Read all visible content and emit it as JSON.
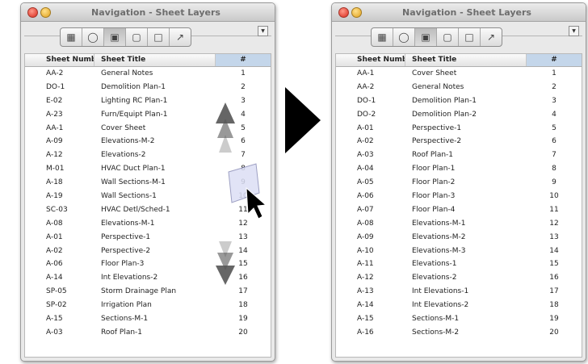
{
  "window_title": "Navigation - Sheet Layers",
  "toolbar_icons": [
    "layers-icon",
    "database-icon",
    "sheet-layers-icon",
    "viewports-icon",
    "document-icon",
    "magic-wand-icon"
  ],
  "columns": {
    "number": "Sheet Number",
    "title": "Sheet Title",
    "order": "#"
  },
  "left_rows": [
    {
      "num": "AA-2",
      "title": "General Notes",
      "idx": "1"
    },
    {
      "num": "DO-1",
      "title": "Demolition Plan-1",
      "idx": "2"
    },
    {
      "num": "E-02",
      "title": "Lighting RC Plan-1",
      "idx": "3"
    },
    {
      "num": "A-23",
      "title": "Furn/Equipt Plan-1",
      "idx": "4"
    },
    {
      "num": "AA-1",
      "title": "Cover Sheet",
      "idx": "5"
    },
    {
      "num": "A-09",
      "title": "Elevations-M-2",
      "idx": "6"
    },
    {
      "num": "A-12",
      "title": "Elevations-2",
      "idx": "7"
    },
    {
      "num": "M-01",
      "title": "HVAC Duct Plan-1",
      "idx": "8"
    },
    {
      "num": "A-18",
      "title": "Wall Sections-M-1",
      "idx": "9"
    },
    {
      "num": "A-19",
      "title": "Wall Sections-1",
      "idx": "10"
    },
    {
      "num": "SC-03",
      "title": "HVAC Detl/Sched-1",
      "idx": "11"
    },
    {
      "num": "A-08",
      "title": "Elevations-M-1",
      "idx": "12"
    },
    {
      "num": "A-01",
      "title": "Perspective-1",
      "idx": "13"
    },
    {
      "num": "A-02",
      "title": "Perspective-2",
      "idx": "14"
    },
    {
      "num": "A-06",
      "title": "Floor Plan-3",
      "idx": "15"
    },
    {
      "num": "A-14",
      "title": "Int Elevations-2",
      "idx": "16"
    },
    {
      "num": "SP-05",
      "title": "Storm Drainage Plan",
      "idx": "17"
    },
    {
      "num": "SP-02",
      "title": "Irrigation Plan",
      "idx": "18"
    },
    {
      "num": "A-15",
      "title": "Sections-M-1",
      "idx": "19"
    },
    {
      "num": "A-03",
      "title": "Roof Plan-1",
      "idx": "20"
    }
  ],
  "right_rows": [
    {
      "num": "AA-1",
      "title": "Cover Sheet",
      "idx": "1"
    },
    {
      "num": "AA-2",
      "title": "General Notes",
      "idx": "2"
    },
    {
      "num": "DO-1",
      "title": "Demolition Plan-1",
      "idx": "3"
    },
    {
      "num": "DO-2",
      "title": "Demolition Plan-2",
      "idx": "4"
    },
    {
      "num": "A-01",
      "title": "Perspective-1",
      "idx": "5"
    },
    {
      "num": "A-02",
      "title": "Perspective-2",
      "idx": "6"
    },
    {
      "num": "A-03",
      "title": "Roof Plan-1",
      "idx": "7"
    },
    {
      "num": "A-04",
      "title": "Floor Plan-1",
      "idx": "8"
    },
    {
      "num": "A-05",
      "title": "Floor Plan-2",
      "idx": "9"
    },
    {
      "num": "A-06",
      "title": "Floor Plan-3",
      "idx": "10"
    },
    {
      "num": "A-07",
      "title": "Floor Plan-4",
      "idx": "11"
    },
    {
      "num": "A-08",
      "title": "Elevations-M-1",
      "idx": "12"
    },
    {
      "num": "A-09",
      "title": "Elevations-M-2",
      "idx": "13"
    },
    {
      "num": "A-10",
      "title": "Elevations-M-3",
      "idx": "14"
    },
    {
      "num": "A-11",
      "title": "Elevations-1",
      "idx": "15"
    },
    {
      "num": "A-12",
      "title": "Elevations-2",
      "idx": "16"
    },
    {
      "num": "A-13",
      "title": "Int Elevations-1",
      "idx": "17"
    },
    {
      "num": "A-14",
      "title": "Int Elevations-2",
      "idx": "18"
    },
    {
      "num": "A-15",
      "title": "Sections-M-1",
      "idx": "19"
    },
    {
      "num": "A-16",
      "title": "Sections-M-2",
      "idx": "20"
    }
  ],
  "colors": {
    "header_selected": "#c4d6ea",
    "drag_arrows": "#555555",
    "transition_arrow": "#000000"
  }
}
